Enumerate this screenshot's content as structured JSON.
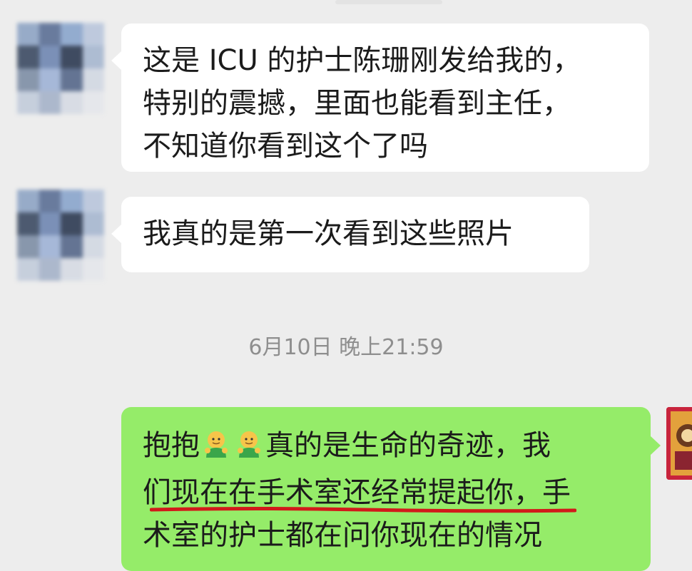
{
  "messages": [
    {
      "sender": "other",
      "lines": [
        "这是 ICU 的护士陈珊刚发给我的，",
        "特别的震撼，里面也能看到主任，",
        "不知道你看到这个了吗"
      ]
    },
    {
      "sender": "other",
      "lines": [
        "我真的是第一次看到这些照片"
      ]
    }
  ],
  "timestamp": "6月10日 晚上21:59",
  "outgoing": {
    "line1_a": "抱抱",
    "line1_b": "真的是生命的奇迹，我",
    "line2": "们现在在手术室还经常提起你，手",
    "line3": "术室的护士都在问你现在的情况",
    "emoji_name": "hug-emoji"
  },
  "colors": {
    "background": "#ededed",
    "incoming_bubble": "#ffffff",
    "outgoing_bubble": "#95ec69",
    "underline": "#d11a1a",
    "timestamp_text": "#8e8e8e"
  }
}
